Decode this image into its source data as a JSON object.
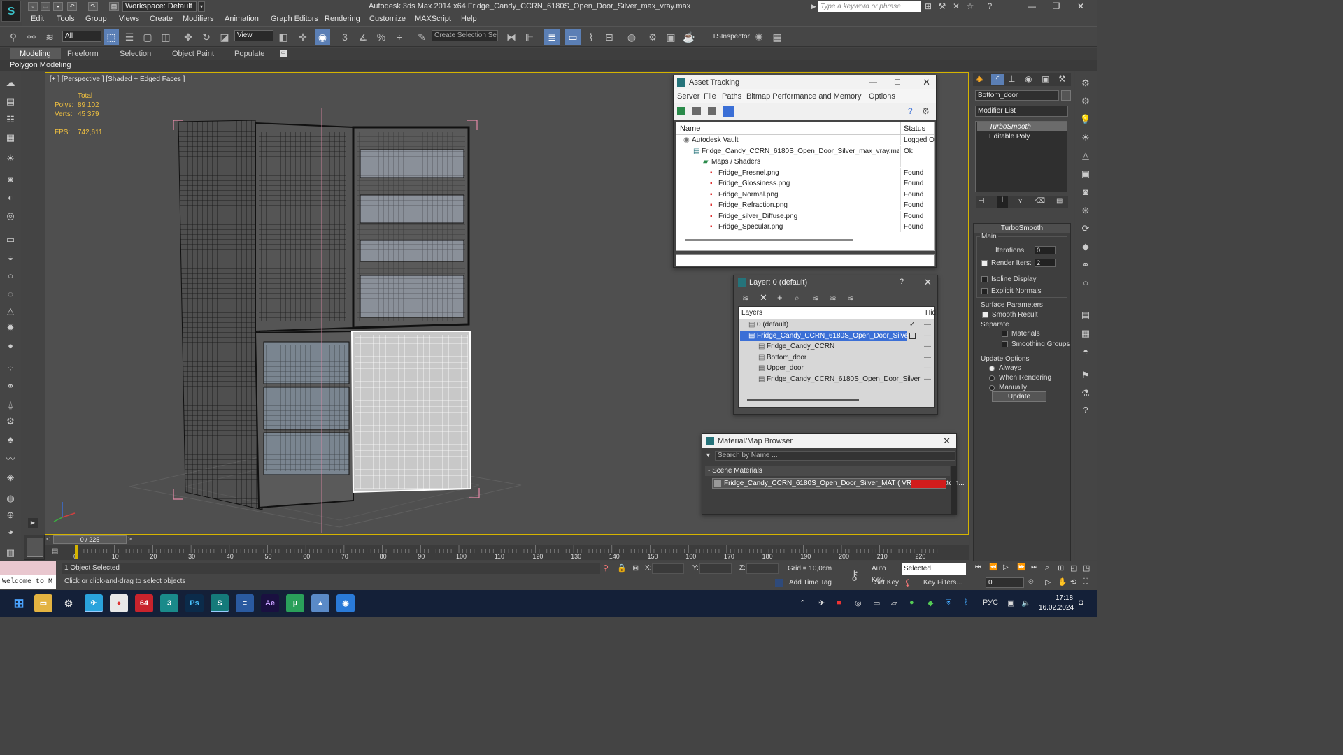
{
  "titlebar": {
    "workspace": "Workspace: Default",
    "title": "Autodesk 3ds Max  2014 x64     Fridge_Candy_CCRN_6180S_Open_Door_Silver_max_vray.max",
    "search_placeholder": "Type a keyword or phrase"
  },
  "menu": [
    "Edit",
    "Tools",
    "Group",
    "Views",
    "Create",
    "Modifiers",
    "Animation",
    "Graph Editors",
    "Rendering",
    "Customize",
    "MAXScript",
    "Help"
  ],
  "toolbar": {
    "selection_filter": "All",
    "ref_coord": "View",
    "selection_set": "Create Selection Se",
    "tsinspector": "TSInspector"
  },
  "ribbon": {
    "tabs": [
      "Modeling",
      "Freeform",
      "Selection",
      "Object Paint",
      "Populate"
    ],
    "sub": "Polygon Modeling"
  },
  "viewport": {
    "label": "[+ ] [Perspective ] [Shaded + Edged Faces ]",
    "stats": {
      "total": "Total",
      "polys_label": "Polys:",
      "polys": "89 102",
      "verts_label": "Verts:",
      "verts": "45 379",
      "fps_label": "FPS:",
      "fps": "742,611"
    }
  },
  "asset_tracking": {
    "title": "Asset Tracking",
    "menu": [
      "Server",
      "File",
      "Paths",
      "Bitmap Performance and Memory",
      "Options"
    ],
    "col_name": "Name",
    "col_status": "Status",
    "rows": [
      {
        "name": "Autodesk Vault",
        "status": "Logged O"
      },
      {
        "name": "Fridge_Candy_CCRN_6180S_Open_Door_Silver_max_vray.max",
        "status": "Ok"
      },
      {
        "name": "Maps / Shaders",
        "status": ""
      },
      {
        "name": "Fridge_Fresnel.png",
        "status": "Found"
      },
      {
        "name": "Fridge_Glossiness.png",
        "status": "Found"
      },
      {
        "name": "Fridge_Normal.png",
        "status": "Found"
      },
      {
        "name": "Fridge_Refraction.png",
        "status": "Found"
      },
      {
        "name": "Fridge_silver_Diffuse.png",
        "status": "Found"
      },
      {
        "name": "Fridge_Specular.png",
        "status": "Found"
      }
    ]
  },
  "layer_dialog": {
    "title": "Layer: 0 (default)",
    "help": "?",
    "col_layers": "Layers",
    "col_hide": "Hid",
    "rows": [
      {
        "name": "0 (default)"
      },
      {
        "name": "Fridge_Candy_CCRN_6180S_Open_Door_Silver"
      },
      {
        "name": "Fridge_Candy_CCRN"
      },
      {
        "name": "Bottom_door"
      },
      {
        "name": "Upper_door"
      },
      {
        "name": "Fridge_Candy_CCRN_6180S_Open_Door_Silver"
      }
    ]
  },
  "material_browser": {
    "title": "Material/Map Browser",
    "search_placeholder": "Search by Name ...",
    "section": "- Scene Materials",
    "item": "Fridge_Candy_CCRN_6180S_Open_Door_Silver_MAT ( VRayMtl ) [Bottom..."
  },
  "command_panel": {
    "object_name": "Bottom_door",
    "modifier_list": "Modifier List",
    "stack": [
      "TurboSmooth",
      "Editable Poly"
    ],
    "rollout_title": "TurboSmooth",
    "main_group": "Main",
    "iterations_label": "Iterations:",
    "iterations": "0",
    "render_iters_label": "Render Iters:",
    "render_iters": "2",
    "isoline": "Isoline Display",
    "explicit_normals": "Explicit Normals",
    "surface_group": "Surface Parameters",
    "smooth_result": "Smooth Result",
    "separate": "Separate",
    "materials": "Materials",
    "smoothing_groups": "Smoothing Groups",
    "update_group": "Update Options",
    "always": "Always",
    "when_rendering": "When Rendering",
    "manually": "Manually",
    "update_btn": "Update"
  },
  "timeline": {
    "frame": "0 / 225",
    "ticks": [
      "0",
      "10",
      "20",
      "30",
      "40",
      "50",
      "60",
      "70",
      "80",
      "90",
      "100",
      "110",
      "120",
      "130",
      "140",
      "150",
      "160",
      "170",
      "180",
      "190",
      "200",
      "210",
      "220"
    ]
  },
  "status": {
    "objects": "1 Object Selected",
    "prompt": "Click or click-and-drag to select objects",
    "welcome": "Welcome to M",
    "x_label": "X:",
    "y_label": "Y:",
    "z_label": "Z:",
    "grid": "Grid = 10,0cm",
    "add_time_tag": "Add Time Tag",
    "auto_key": "Auto Key",
    "set_key": "Set Key",
    "selected": "Selected",
    "key_filters": "Key Filters...",
    "frame_field": "0"
  },
  "taskbar": {
    "lang": "РУС",
    "time": "17:18",
    "date": "16.02.2024",
    "badge": "64"
  },
  "colors": {
    "accent": "#25737a",
    "selection": "#3b6fd6",
    "viewport_border": "#d5b400"
  }
}
